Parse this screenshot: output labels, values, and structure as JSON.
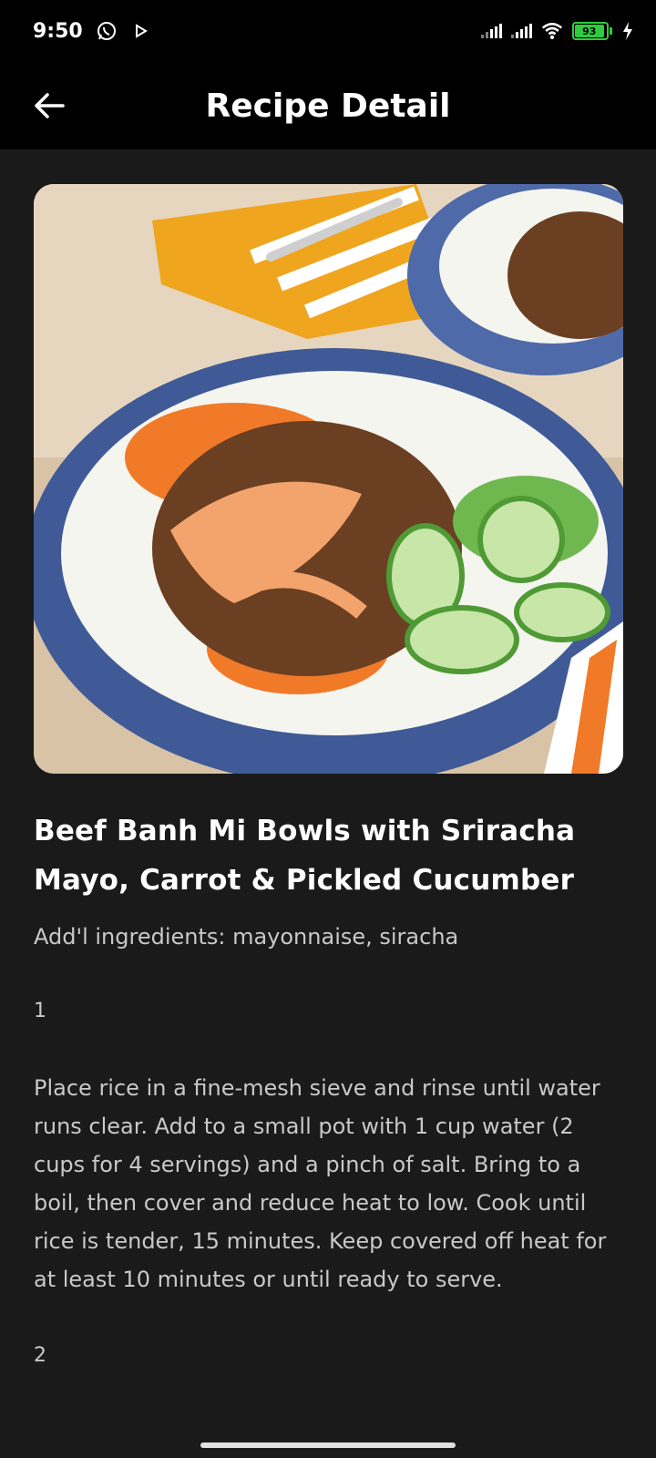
{
  "status_bar": {
    "time": "9:50",
    "battery_level": "93",
    "icons": [
      "whatsapp-icon",
      "play-icon",
      "signal-icon",
      "signal-icon",
      "wifi-icon",
      "battery-icon",
      "charging-icon"
    ]
  },
  "app_bar": {
    "title": "Recipe Detail",
    "back_icon": "arrow-left-icon"
  },
  "recipe": {
    "image_alt": "Beef banh mi bowl",
    "title": "Beef Banh Mi Bowls with Sriracha Mayo, Carrot & Pickled Cucumber",
    "additional_ingredients": "Add'l ingredients: mayonnaise, siracha",
    "steps": [
      {
        "number": "1",
        "text": "Place rice in a fine-mesh sieve and rinse until water runs clear. Add to a small pot with 1 cup water (2 cups for 4 servings) and a pinch of salt. Bring to a boil, then cover and reduce heat to low. Cook until rice is tender, 15 minutes. Keep covered off heat for at least 10 minutes or until ready to serve."
      },
      {
        "number": "2",
        "text": ""
      }
    ]
  },
  "colors": {
    "background": "#1a1a1a",
    "bar": "#000000",
    "text_primary": "#ffffff",
    "text_secondary": "#c8c8c8",
    "battery": "#2ecc40"
  }
}
